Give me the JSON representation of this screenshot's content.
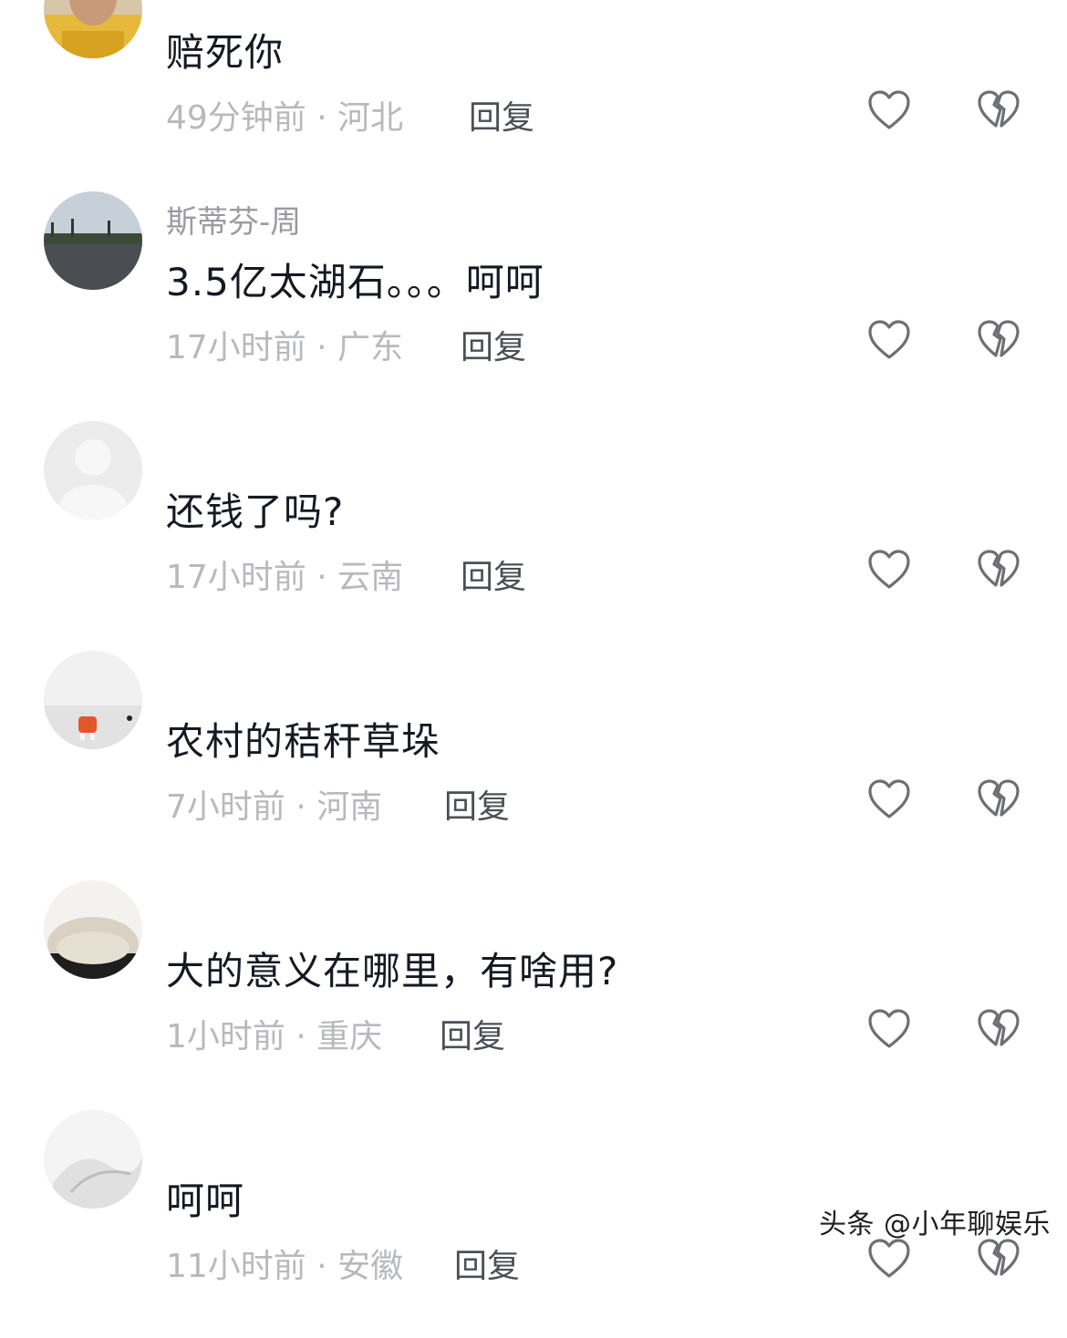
{
  "comments": [
    {
      "username": "",
      "text": "赔死你",
      "time_location": "49分钟前 · 河北",
      "reply_label": "回复"
    },
    {
      "username": "斯蒂芬-周",
      "text": "3.5亿太湖石。。。呵呵",
      "time_location": "17小时前 · 广东",
      "reply_label": "回复"
    },
    {
      "username": "",
      "text": "还钱了吗?",
      "time_location": "17小时前 · 云南",
      "reply_label": "回复"
    },
    {
      "username": "",
      "text": "农村的秸秆草垛",
      "time_location": "7小时前 · 河南",
      "reply_label": "回复"
    },
    {
      "username": "",
      "text": "大的意义在哪里，有啥用?",
      "time_location": "1小时前 · 重庆",
      "reply_label": "回复"
    },
    {
      "username": "",
      "text": "呵呵",
      "time_location": "11小时前 · 安徽",
      "reply_label": "回复"
    }
  ],
  "icons": {
    "like": "heart-outline-icon",
    "dislike": "broken-heart-icon"
  },
  "watermark": "头条 @小年聊娱乐",
  "colors": {
    "text": "#161823",
    "meta": "#b8b9bd",
    "username": "#9a9ba1",
    "reply": "#4d4f57",
    "icon": "#6e6f75"
  }
}
